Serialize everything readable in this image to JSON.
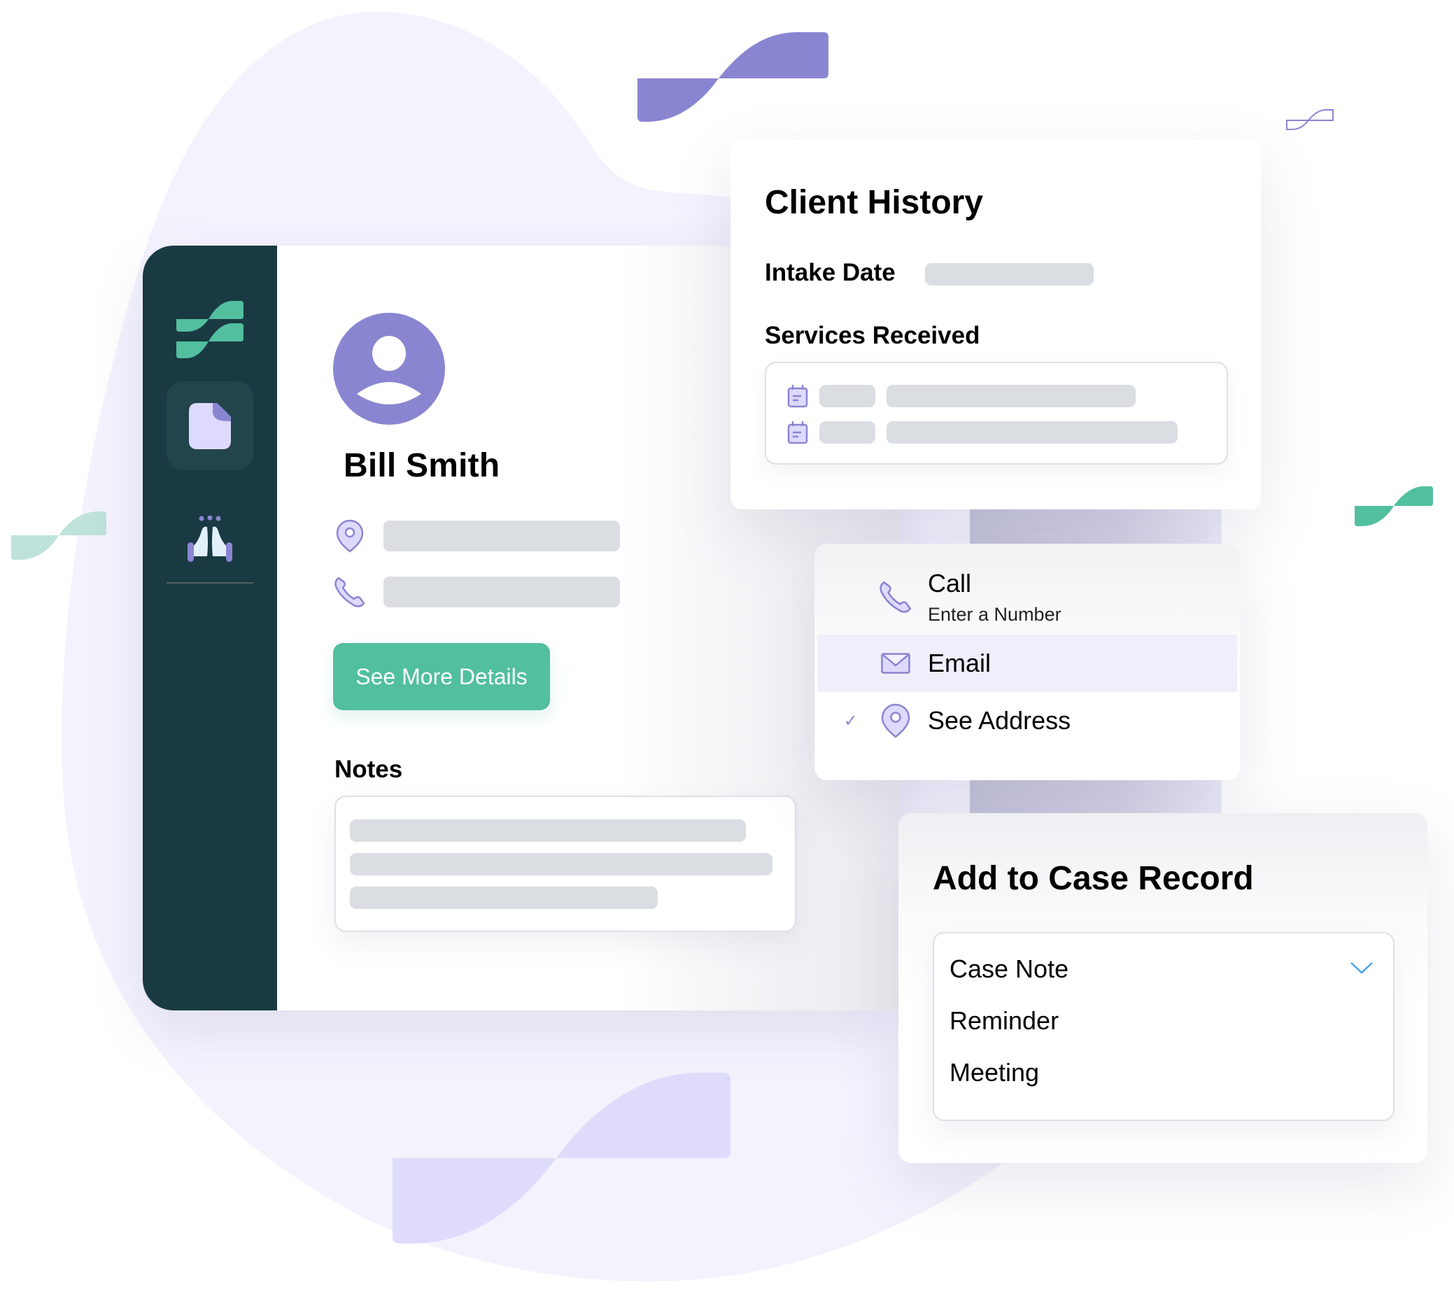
{
  "colors": {
    "sidebar_bg": "#193a42",
    "brand_green": "#52bf9f",
    "brand_purple": "#8a85d1",
    "lavender_bg": "#f3f2fd",
    "skeleton": "#dadde1",
    "highlight": "#efeefa",
    "chevron": "#4aa3ee"
  },
  "sidebar": {
    "logo_icon": "app-logo-wave",
    "items": [
      {
        "icon": "document-icon",
        "active": true
      },
      {
        "icon": "praying-hands-icon",
        "active": false
      }
    ]
  },
  "profile": {
    "avatar_icon": "user-avatar-icon",
    "name": "Bill Smith",
    "rows": [
      {
        "icon": "location-pin-icon"
      },
      {
        "icon": "phone-icon"
      }
    ],
    "button_label": "See More Details",
    "notes_label": "Notes"
  },
  "client_history": {
    "title": "Client History",
    "intake_label": "Intake Date",
    "services_label": "Services Received",
    "service_icon": "calendar-note-icon"
  },
  "contact_menu": {
    "items": [
      {
        "icon": "phone-icon",
        "label": "Call",
        "sublabel": "Enter a Number",
        "checked": false,
        "highlighted": false
      },
      {
        "icon": "mail-icon",
        "label": "Email",
        "checked": false,
        "highlighted": true
      },
      {
        "icon": "location-pin-icon",
        "label": "See Address",
        "checked": true,
        "highlighted": false
      }
    ],
    "check_glyph": "✓"
  },
  "case_record": {
    "title": "Add to Case Record",
    "selected": "Case Note",
    "options": [
      "Case Note",
      "Reminder",
      "Meeting"
    ]
  }
}
